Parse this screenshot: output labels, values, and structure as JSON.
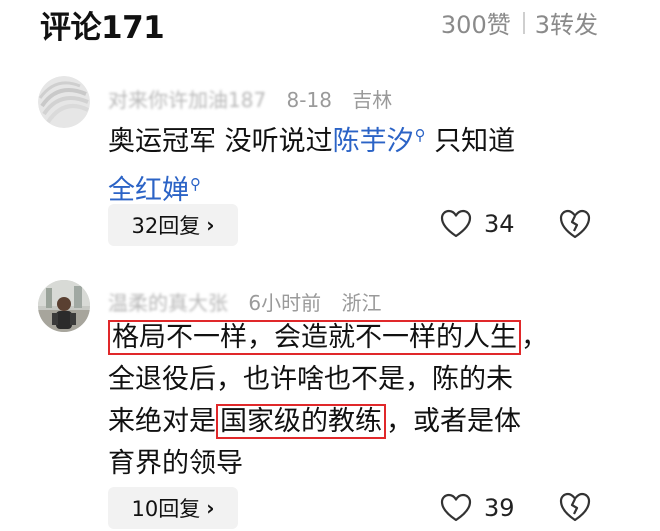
{
  "header": {
    "title": "评论171",
    "likes": "300赞",
    "shares": "3转发"
  },
  "comments": [
    {
      "username": "对来你许加油187",
      "date": "8-18",
      "location": "吉林",
      "text_line1_a": "奥运冠军 没听说过",
      "link1": "陈芋汐",
      "text_line1_b": "只知道",
      "link2": "全红婵",
      "replies": "32回复",
      "like_count": "34"
    },
    {
      "username": "温柔的真大张",
      "time": "6小时前",
      "location": "浙江",
      "line1_highlight": "格局不一样，会造就不一样的人生",
      "line1_tail": "，",
      "line2": "全退役后，也许啥也不是，陈的未",
      "line3_a": "来绝对是",
      "line3_highlight": "国家级的教练",
      "line3_b": "，或者是体",
      "line4": "育界的领导",
      "replies": "10回复",
      "like_count": "39"
    }
  ],
  "colors": {
    "link": "#2b63c6",
    "highlight_border": "#e0282a",
    "meta_text": "#9a9a9a",
    "reply_bg": "#f2f2f2"
  }
}
